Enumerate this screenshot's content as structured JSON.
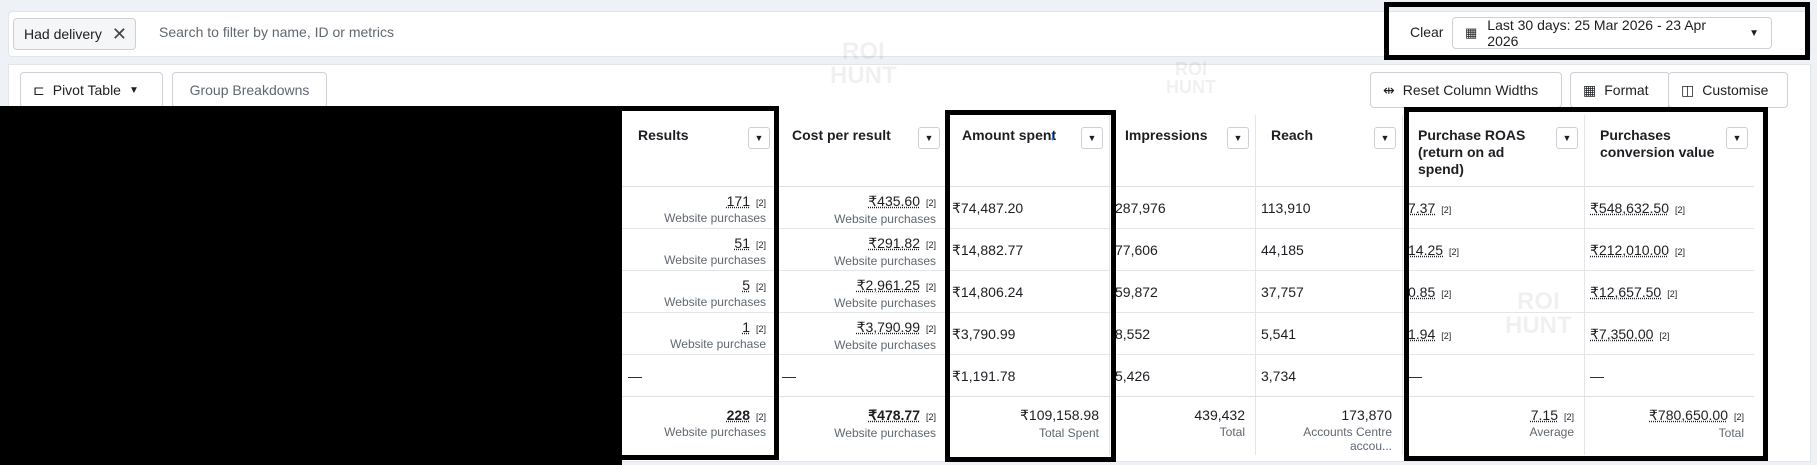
{
  "filter": {
    "chip": "Had delivery",
    "search_placeholder": "Search to filter by name, ID or metrics"
  },
  "date": {
    "clear": "Clear",
    "range": "Last 30 days: 25 Mar 2026 - 23 Apr 2026"
  },
  "toolbar": {
    "pivot": "Pivot Table",
    "group": "Group Breakdowns",
    "reset": "Reset Column Widths",
    "format": "Format",
    "customise": "Customise"
  },
  "columns": {
    "results": "Results",
    "cpr": "Cost per result",
    "amount": "Amount spent",
    "impressions": "Impressions",
    "reach": "Reach",
    "roas": "Purchase ROAS (return on ad spend)",
    "pcv": "Purchases conversion value"
  },
  "rows": [
    {
      "results": "171",
      "results_sub": "Website purchases",
      "cpr": "₹435.60",
      "cpr_sub": "Website purchases",
      "amount": "₹74,487.20",
      "impressions": "287,976",
      "reach": "113,910",
      "roas": "7.37",
      "pcv": "₹548,632.50"
    },
    {
      "results": "51",
      "results_sub": "Website purchases",
      "cpr": "₹291.82",
      "cpr_sub": "Website purchases",
      "amount": "₹14,882.77",
      "impressions": "77,606",
      "reach": "44,185",
      "roas": "14.25",
      "pcv": "₹212,010.00"
    },
    {
      "results": "5",
      "results_sub": "Website purchases",
      "cpr": "₹2,961.25",
      "cpr_sub": "Website purchases",
      "amount": "₹14,806.24",
      "impressions": "59,872",
      "reach": "37,757",
      "roas": "0.85",
      "pcv": "₹12,657.50"
    },
    {
      "results": "1",
      "results_sub": "Website purchase",
      "cpr": "₹3,790.99",
      "cpr_sub": "Website purchases",
      "amount": "₹3,790.99",
      "impressions": "8,552",
      "reach": "5,541",
      "roas": "1.94",
      "pcv": "₹7,350.00"
    },
    {
      "results": "—",
      "results_sub": "",
      "cpr": "—",
      "cpr_sub": "",
      "amount": "₹1,191.78",
      "impressions": "5,426",
      "reach": "3,734",
      "roas": "—",
      "pcv": "—"
    }
  ],
  "footnote": "[2]",
  "totals": {
    "results": "228",
    "results_sub": "Website purchases",
    "cpr": "₹478.77",
    "cpr_sub": "Website purchases",
    "amount": "₹109,158.98",
    "amount_sub": "Total Spent",
    "impressions": "439,432",
    "impressions_sub": "Total",
    "reach": "173,870",
    "reach_sub": "Accounts Centre accou...",
    "roas": "7.15",
    "roas_sub": "Average",
    "pcv": "₹780,650.00",
    "pcv_sub": "Total"
  },
  "watermark": {
    "line1": "ROI",
    "line2": "HUNT"
  }
}
